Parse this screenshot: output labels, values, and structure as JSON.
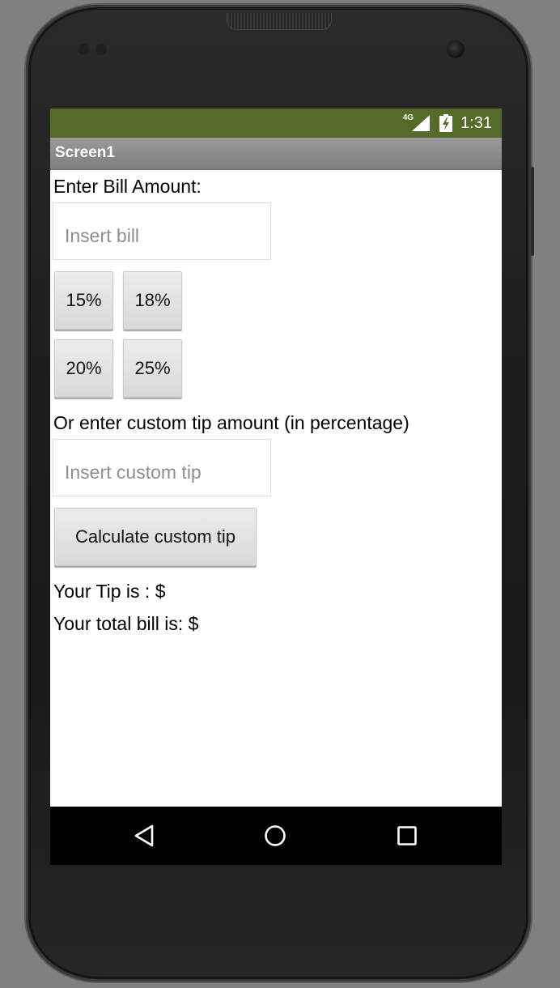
{
  "status_bar": {
    "network_label": "4G",
    "time": "1:31",
    "background_color": "#556b2a"
  },
  "app_bar": {
    "title": "Screen1"
  },
  "bill": {
    "label": "Enter Bill Amount:",
    "placeholder": "Insert bill",
    "value": ""
  },
  "tip_buttons": [
    {
      "label": "15%"
    },
    {
      "label": "18%"
    },
    {
      "label": "20%"
    },
    {
      "label": "25%"
    }
  ],
  "custom_tip": {
    "label": "Or enter custom tip amount (in percentage)",
    "placeholder": "Insert custom tip",
    "value": "",
    "button_label": "Calculate custom tip"
  },
  "results": {
    "tip_text": "Your Tip is : $",
    "total_text": "Your total bill is: $"
  },
  "nav_bar": {
    "icons": [
      "back-icon",
      "home-icon",
      "recents-icon"
    ]
  }
}
